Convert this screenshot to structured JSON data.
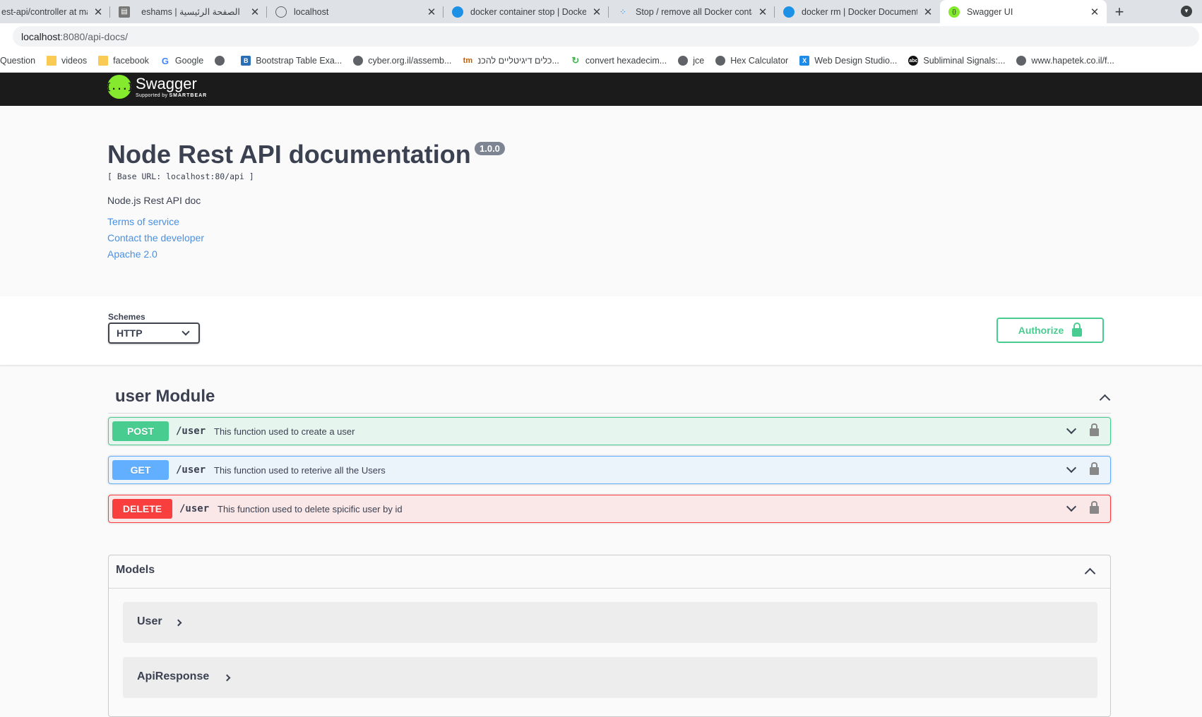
{
  "browser": {
    "tabs": [
      {
        "title": "est-api/controller at ma",
        "active": false
      },
      {
        "title": "eshams | الصفحة الرئيسية",
        "active": false
      },
      {
        "title": "localhost",
        "active": false
      },
      {
        "title": "docker container stop | Docker D",
        "active": false
      },
      {
        "title": "Stop / remove all Docker contai",
        "active": false
      },
      {
        "title": "docker rm | Docker Documentati",
        "active": false
      },
      {
        "title": "Swagger UI",
        "active": true
      }
    ],
    "address": {
      "host": "localhost",
      "path": ":8080/api-docs/"
    },
    "bookmarks": [
      "Question",
      "videos",
      "facebook",
      "Google",
      "",
      "Bootstrap Table Exa...",
      "cyber.org.il/assemb...",
      "כלים דיגיטליים להכנ...",
      "convert hexadecim...",
      "jce",
      "Hex Calculator",
      "Web Design Studio...",
      "Subliminal Signals:...",
      "www.hapetek.co.il/f..."
    ]
  },
  "swagger": {
    "logo": {
      "name": "Swagger",
      "sub_prefix": "Supported by",
      "sub_brand": "SMARTBEAR",
      "symbol": "{...}"
    },
    "info": {
      "title": "Node Rest API documentation",
      "version": "1.0.0",
      "base_url": "[ Base URL: localhost:80/api ]",
      "description": "Node.js Rest API doc",
      "links": [
        "Terms of service",
        "Contact the developer",
        "Apache 2.0"
      ]
    },
    "schemes": {
      "label": "Schemes",
      "selected": "HTTP"
    },
    "authorize_label": "Authorize",
    "tag": "user Module",
    "operations": [
      {
        "method": "POST",
        "path": "/user",
        "summary": "This function used to create a user"
      },
      {
        "method": "GET",
        "path": "/user",
        "summary": "This function used to reterive all the Users"
      },
      {
        "method": "DELETE",
        "path": "/user",
        "summary": "This function used to delete spicific user by id"
      }
    ],
    "models": {
      "title": "Models",
      "items": [
        "User",
        "ApiResponse"
      ]
    }
  },
  "colors": {
    "post": "#49cc90",
    "get": "#61affe",
    "delete": "#f93e3e",
    "topbar": "#1b1b1b",
    "link": "#4990e2"
  }
}
